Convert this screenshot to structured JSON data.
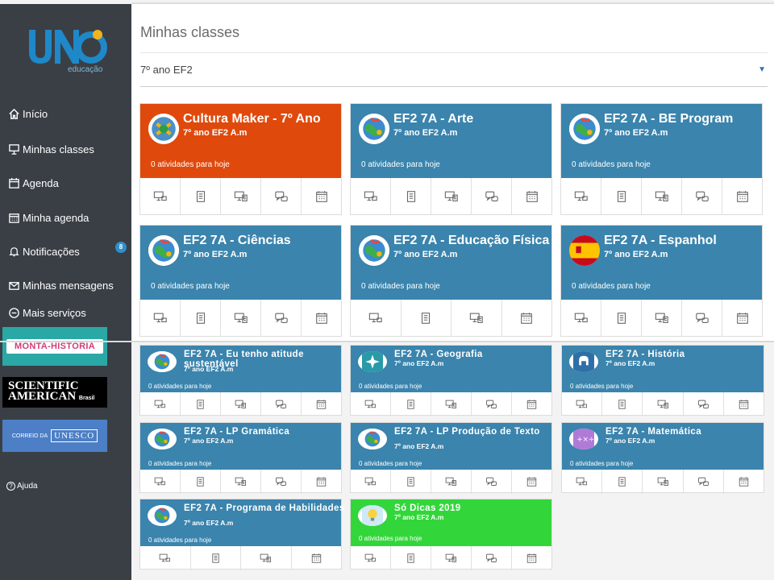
{
  "brand": {
    "logo_text": "educação"
  },
  "sidebar": {
    "items": [
      {
        "label": "Início",
        "icon": "home-icon"
      },
      {
        "label": "Minhas classes",
        "icon": "presentation-icon"
      },
      {
        "label": "Agenda",
        "icon": "calendar-icon"
      },
      {
        "label": "Minha agenda",
        "icon": "calendar-grid-icon"
      },
      {
        "label": "Notificações",
        "icon": "bell-icon",
        "badge": "8"
      },
      {
        "label": "Minhas mensagens",
        "icon": "envelope-icon"
      },
      {
        "label": "Mais serviços",
        "icon": "minus-circle-icon"
      }
    ],
    "banners": {
      "monta": "MONTA-HISTÓRIA",
      "sciam_line1": "SCIENTIFIC",
      "sciam_line2": "AMERICAN",
      "sciam_sub": "Brasil",
      "unesco_pre": "CORREIO DA",
      "unesco": "UNESCO"
    },
    "help": "Ajuda"
  },
  "main": {
    "title": "Minhas classes",
    "filter": "7º ano EF2"
  },
  "colors": {
    "orange": "#e0490c",
    "blue": "#3a84ad",
    "green": "#33d63a"
  },
  "cards": [
    {
      "title": "Cultura Maker - 7º Ano",
      "sub": "7º ano EF2 A.m",
      "act": "0 atividades para hoje",
      "color": "#e0490c"
    },
    {
      "title": "EF2 7A - Arte",
      "sub": "7º ano EF2 A.m",
      "act": "0 atividades para hoje",
      "color": "#3a84ad"
    },
    {
      "title": "EF2 7A - BE Program",
      "sub": "7º ano EF2 A.m",
      "act": "0 atividades para hoje",
      "color": "#3a84ad"
    },
    {
      "title": "EF2 7A - Ciências",
      "sub": "7º ano EF2 A.m",
      "act": "0 atividades para hoje",
      "color": "#3a84ad"
    },
    {
      "title": "EF2 7A - Educação Física",
      "sub": "7º ano EF2 A.m",
      "act": "0 atividades para hoje",
      "color": "#3a84ad"
    },
    {
      "title": "EF2 7A - Espanhol",
      "sub": "7º ano EF2 A.m",
      "act": "0 atividades para hoje",
      "color": "#3a84ad"
    },
    {
      "title": "EF2 7A - Eu tenho atitude sustentável",
      "sub": "7º ano EF2 A.m",
      "act": "0 atividades para hoje",
      "color": "#3a84ad"
    },
    {
      "title": "EF2 7A - Geografia",
      "sub": "7º ano EF2 A.m",
      "act": "0 atividades para hoje",
      "color": "#3a84ad"
    },
    {
      "title": "EF2 7A - História",
      "sub": "7º ano EF2 A.m",
      "act": "0 atividades para hoje",
      "color": "#3a84ad"
    },
    {
      "title": "EF2 7A - LP Gramática",
      "sub": "7º ano EF2 A.m",
      "act": "0 atividades para hoje",
      "color": "#3a84ad"
    },
    {
      "title": "EF2 7A - LP Produção de Texto",
      "sub": "7º ano EF2 A.m",
      "act": "0 atividades para hoje",
      "color": "#3a84ad"
    },
    {
      "title": "EF2 7A - Matemática",
      "sub": "7º ano EF2 A.m",
      "act": "0 atividades para hoje",
      "color": "#3a84ad"
    },
    {
      "title": "EF2 7A - Programa de Habilidades",
      "sub": "7º ano EF2 A.m",
      "act": "0 atividades para hoje",
      "color": "#3a84ad"
    },
    {
      "title": "Só Dicas 2019",
      "sub": "7º ano EF2 A.m",
      "act": "0 atividades para hoje",
      "color": "#33d63a"
    }
  ],
  "card_actions": [
    "presentation-icon",
    "document-icon",
    "assignment-icon",
    "chat-icon",
    "calendar-grid-icon"
  ]
}
